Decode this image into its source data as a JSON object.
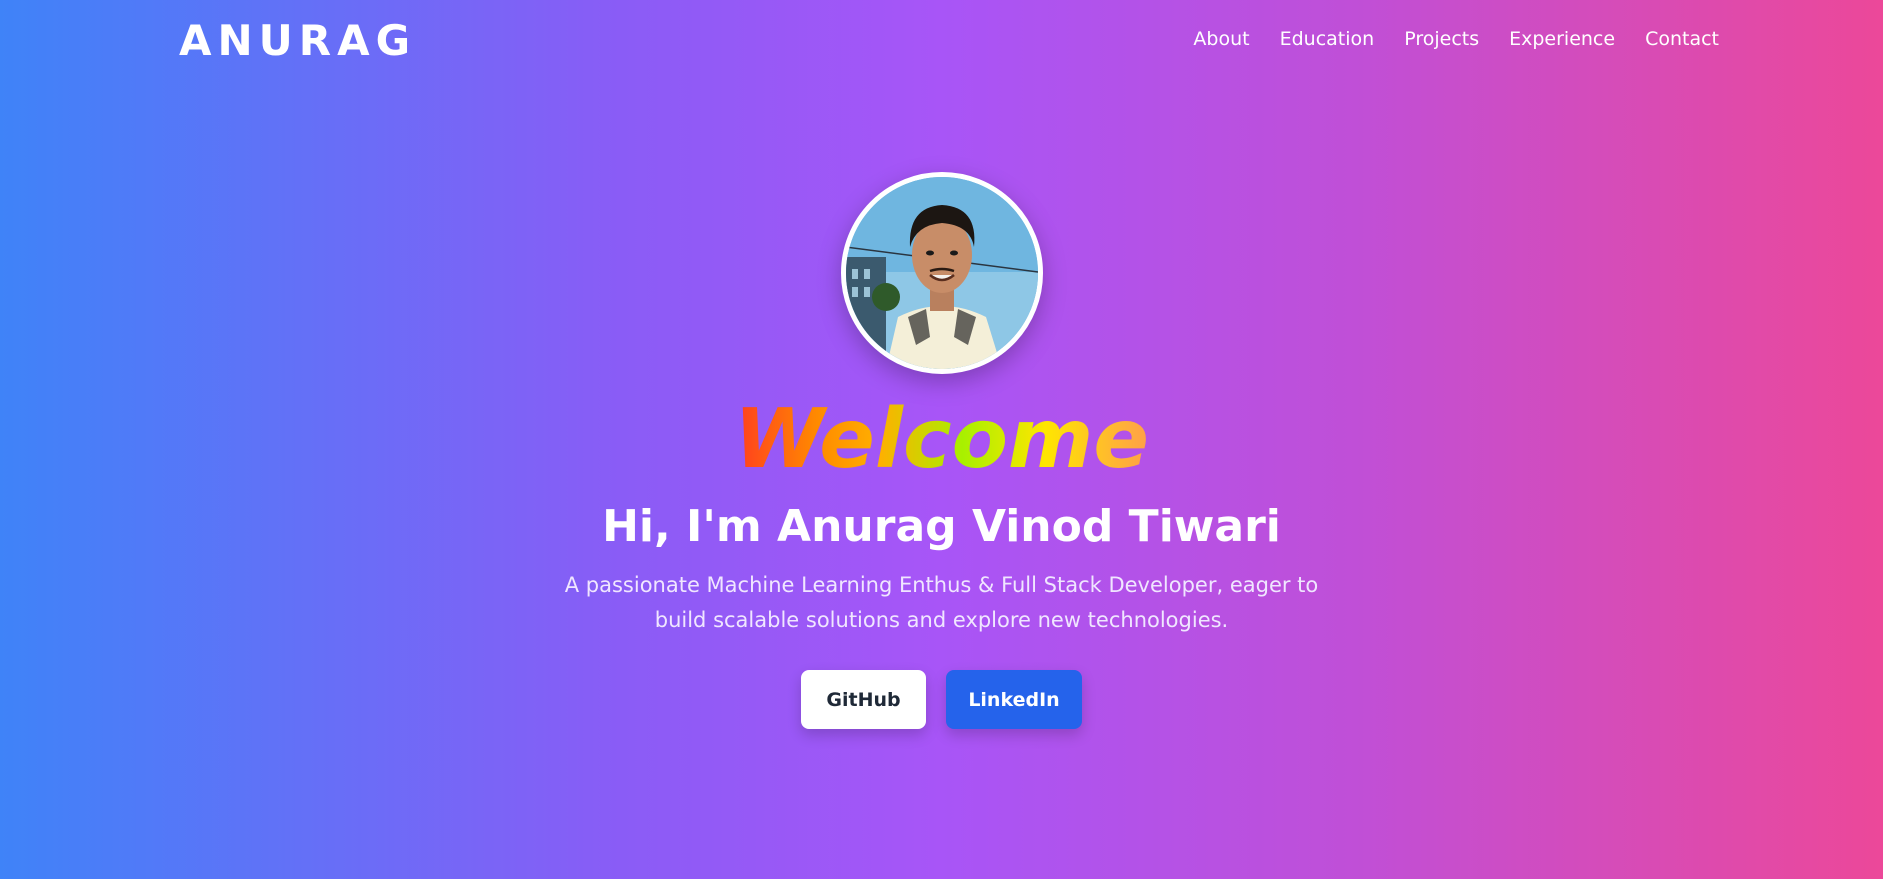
{
  "navbar": {
    "brand": "ANURAG",
    "links": [
      {
        "label": "About"
      },
      {
        "label": "Education"
      },
      {
        "label": "Projects"
      },
      {
        "label": "Experience"
      },
      {
        "label": "Contact"
      }
    ]
  },
  "hero": {
    "avatar_icon": "profile-photo",
    "welcome": "Welcome",
    "headline": "Hi, I'm Anurag Vinod Tiwari",
    "tagline": "A passionate Machine Learning Enthus & Full Stack Developer, eager to build scalable solutions and explore new technologies.",
    "buttons": {
      "github": "GitHub",
      "linkedin": "LinkedIn"
    }
  },
  "colors": {
    "gradient_start": "#3f83f8",
    "gradient_mid": "#a855f7",
    "gradient_end": "#ec4899",
    "linkedin_button": "#2563eb",
    "github_button": "#ffffff"
  }
}
